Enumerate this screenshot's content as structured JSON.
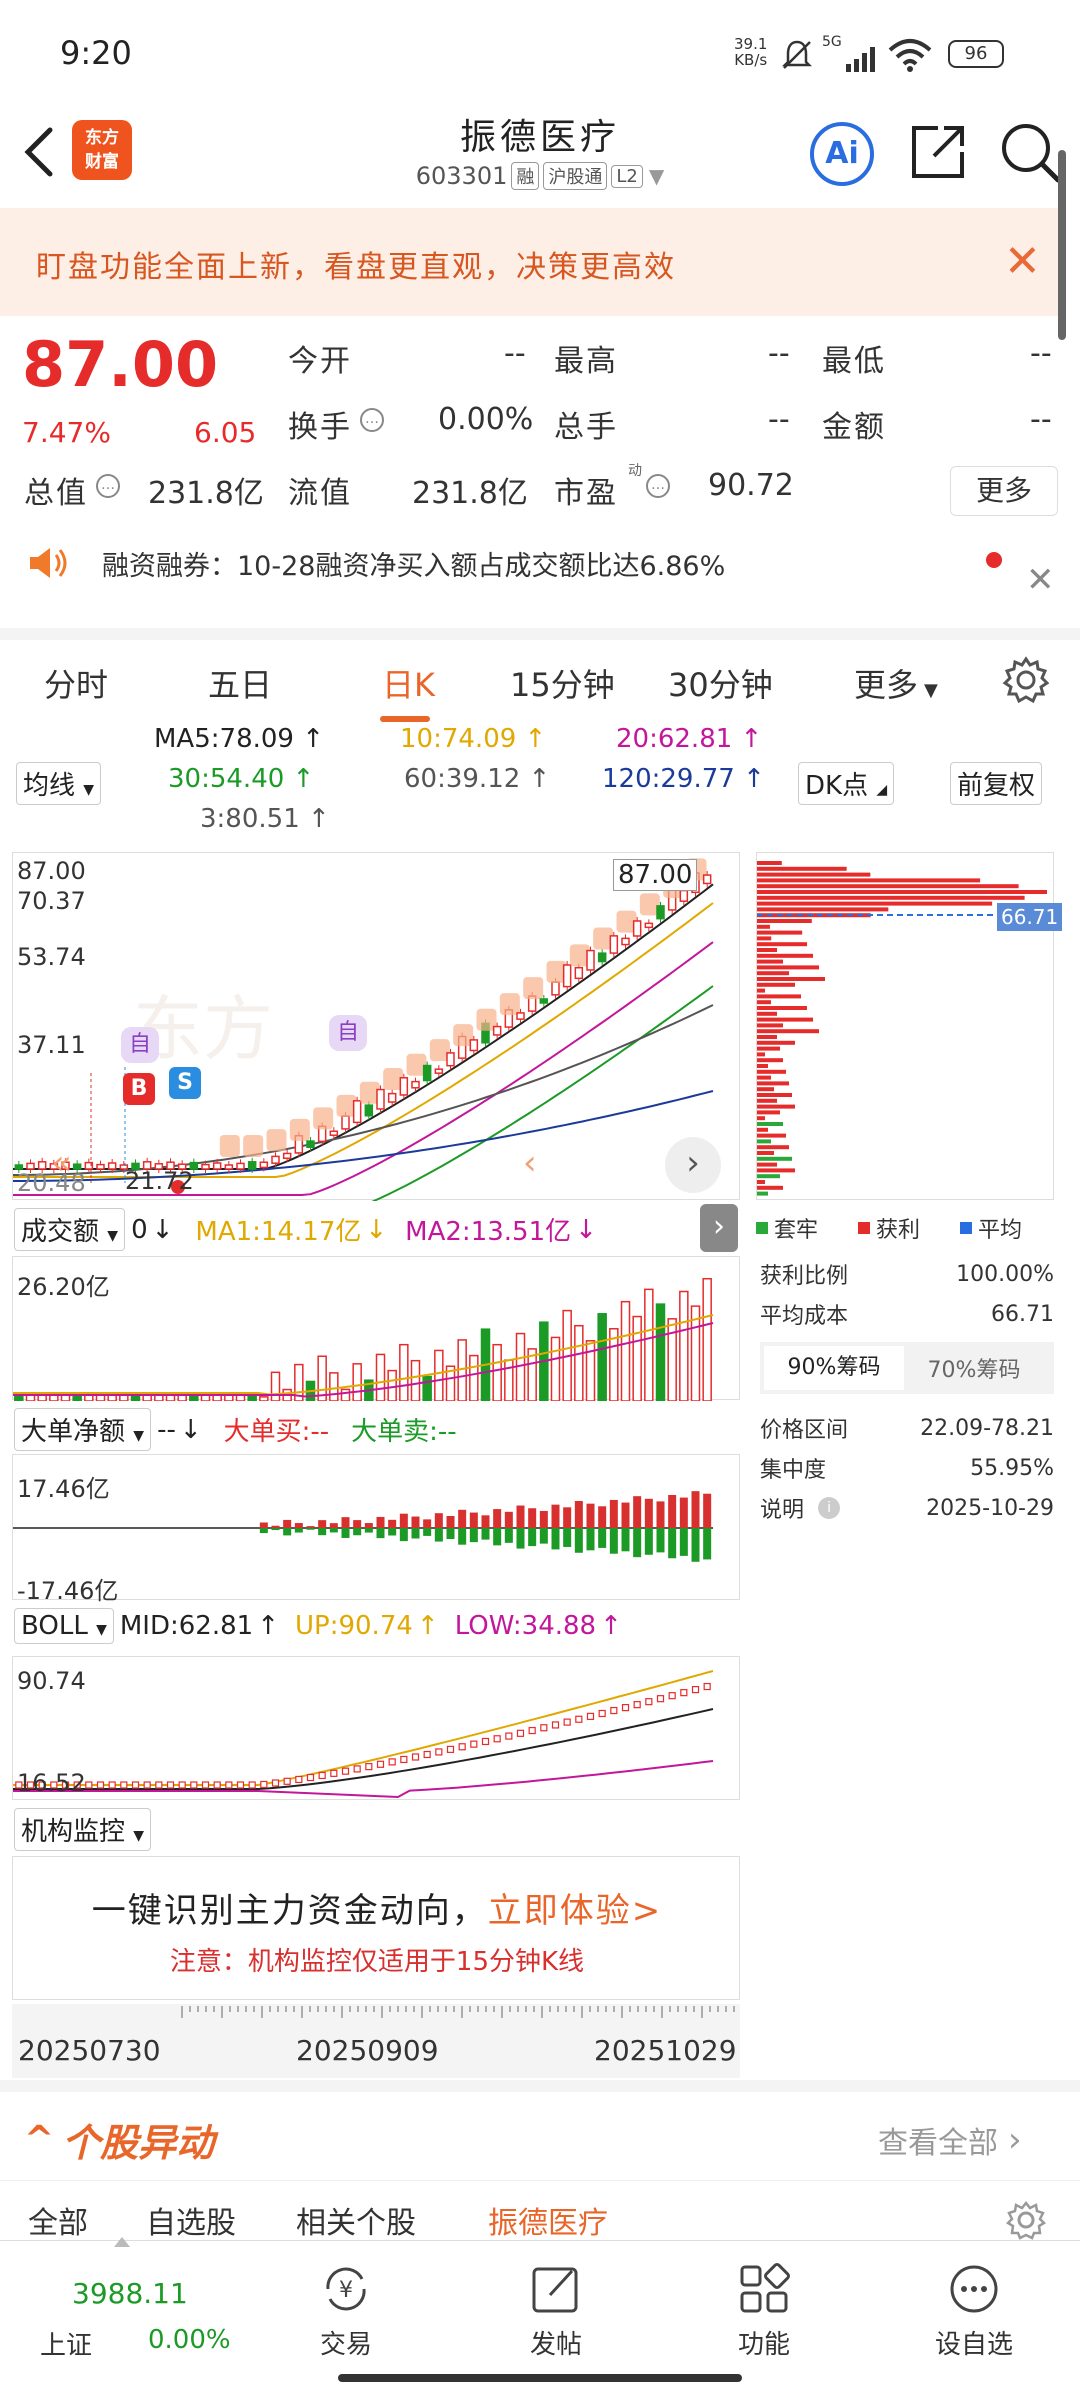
{
  "status_bar": {
    "time": "9:20",
    "net_speed": "39.1",
    "net_unit": "KB/s",
    "signal": "5G",
    "battery": "96"
  },
  "header": {
    "logo_text_1": "东方",
    "logo_text_2": "财富",
    "stock_name": "振德医疗",
    "stock_code": "603301",
    "tag_margin": "融",
    "tag_connect": "沪股通",
    "tag_level": "L2",
    "ai_label": "Ai"
  },
  "banner": {
    "text": "盯盘功能全面上新，看盘更直观，决策更高效"
  },
  "quote": {
    "price": "87.00",
    "change_pct": "7.47%",
    "change_val": "6.05",
    "open_label": "今开",
    "open_value": "--",
    "high_label": "最高",
    "high_value": "--",
    "low_label": "最低",
    "low_value": "--",
    "turnover_label": "换手",
    "turnover_value": "0.00%",
    "vol_label": "总手",
    "vol_value": "--",
    "amount_label": "金额",
    "amount_value": "--",
    "mktcap_label": "总值",
    "mktcap_value": "231.8亿",
    "float_label": "流值",
    "float_value": "231.8亿",
    "pe_label": "市盈",
    "pe_sup": "动",
    "pe_value": "90.72",
    "more_label": "更多"
  },
  "news": {
    "text": "融资融券：10-28融资净买入额占成交额比达6.86%"
  },
  "tabs": [
    "分时",
    "五日",
    "日K",
    "15分钟",
    "30分钟",
    "更多"
  ],
  "active_tab": 2,
  "ma": {
    "selector": "均线",
    "ma5": "MA5:78.09",
    "ma10": "10:74.09",
    "ma20": "20:62.81",
    "ma30": "30:54.40",
    "ma60": "60:39.12",
    "ma120": "120:29.77",
    "ma3": "3:80.51",
    "dk_label": "DK点",
    "adjust_label": "前复权",
    "colors": {
      "ma5": "#222222",
      "ma10": "#e0a800",
      "ma20": "#c2179b",
      "ma30": "#1b9a26",
      "ma60": "#555555",
      "ma120": "#1b3b9a"
    }
  },
  "kline": {
    "y_labels": [
      "87.00",
      "70.37",
      "53.74",
      "37.11",
      "20.48"
    ],
    "last_price": "87.00",
    "low_mark": "21.72",
    "buy_mark": "B",
    "sell_mark": "S",
    "self_mark_1": "自",
    "self_mark_2": "自"
  },
  "chips": {
    "cost_marker": "66.71",
    "legend_trapped": "套牢",
    "legend_profit": "获利",
    "legend_avg": "平均",
    "profit_ratio_label": "获利比例",
    "profit_ratio_value": "100.00%",
    "avg_cost_label": "平均成本",
    "avg_cost_value": "66.71",
    "tab_90": "90%筹码",
    "tab_70": "70%筹码",
    "range_label": "价格区间",
    "range_value": "22.09-78.21",
    "concentration_label": "集中度",
    "concentration_value": "55.95%",
    "note_label": "说明",
    "note_value": "2025-10-29"
  },
  "volume": {
    "selector": "成交额",
    "current": "0",
    "ma1": "MA1:14.17亿",
    "ma2": "MA2:13.51亿",
    "y_top": "26.20亿"
  },
  "bigorder": {
    "selector": "大单净额",
    "current": "--",
    "buy": "大单买:--",
    "sell": "大单卖:--",
    "y_top": "17.46亿",
    "y_bottom": "-17.46亿"
  },
  "boll": {
    "selector": "BOLL",
    "mid": "MID:62.81",
    "up": "UP:90.74",
    "low": "LOW:34.88",
    "y_top": "90.74",
    "y_bottom": "16.52"
  },
  "institution": {
    "selector": "机构监控",
    "promo_text": "一键识别主力资金动向，",
    "promo_link": "立即体验>",
    "note": "注意：机构监控仅适用于15分钟K线"
  },
  "dates": [
    "20250730",
    "20250909",
    "20251029"
  ],
  "unusual": {
    "title": "个股异动",
    "view_all": "查看全部",
    "tabs": [
      "全部",
      "自选股",
      "相关个股",
      "振德医疗"
    ],
    "active_tab": 3
  },
  "bottom_nav": {
    "index_value": "3988.11",
    "index_name": "上证",
    "index_change": "0.00%",
    "trade": "交易",
    "post": "发帖",
    "func": "功能",
    "watchlist": "设自选"
  }
}
